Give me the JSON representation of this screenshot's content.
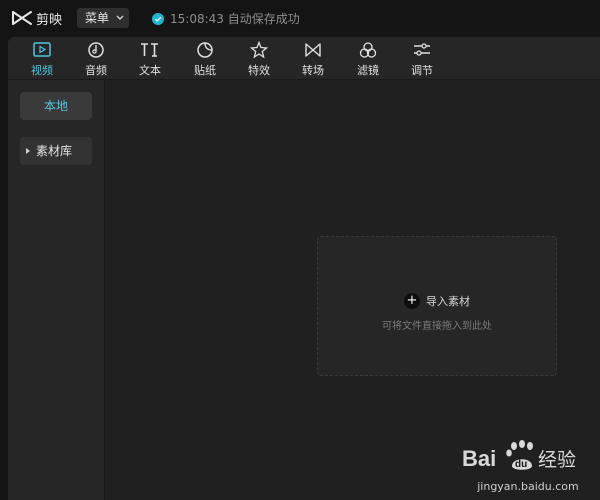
{
  "app": {
    "name": "剪映",
    "menu_label": "菜单",
    "status": "15:08:43 自动保存成功",
    "accent_color": "#4ec5e0"
  },
  "toolbar": {
    "items": [
      {
        "label": "视频",
        "icon": "video-icon",
        "active": true
      },
      {
        "label": "音频",
        "icon": "audio-icon"
      },
      {
        "label": "文本",
        "icon": "text-icon"
      },
      {
        "label": "贴纸",
        "icon": "sticker-icon"
      },
      {
        "label": "特效",
        "icon": "effects-icon"
      },
      {
        "label": "转场",
        "icon": "transition-icon"
      },
      {
        "label": "滤镜",
        "icon": "filter-icon"
      },
      {
        "label": "调节",
        "icon": "adjust-icon"
      }
    ]
  },
  "sidebar": {
    "items": [
      {
        "label": "本地",
        "active": true
      },
      {
        "label": "素材库"
      }
    ]
  },
  "dropzone": {
    "import_label": "导入素材",
    "hint": "可将文件直接拖入到此处"
  },
  "watermark": {
    "brand": "Bai du 经验",
    "url": "jingyan.baidu.com"
  }
}
